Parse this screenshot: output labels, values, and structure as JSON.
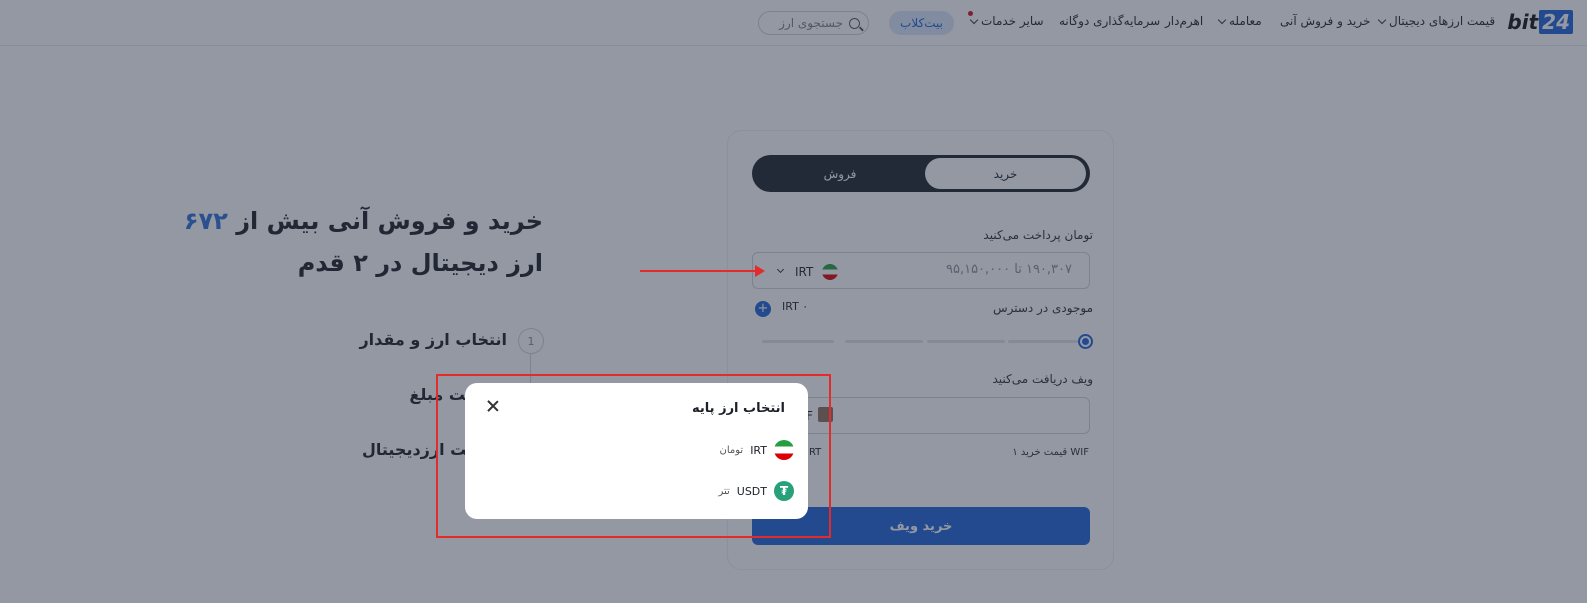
{
  "header": {
    "logo_text": "bit",
    "logo_num": "24",
    "nav": {
      "prices": "قیمت ارزهای دیجیتال",
      "instant": "خرید و فروش آنی",
      "trade": "معامله",
      "leverage": "اهرم‌دار",
      "dual": "سرمایه‌گذاری دوگانه",
      "other": "سایر خدمات"
    },
    "club_label": "بیت‌کلاب",
    "search_placeholder": "جستجوی ارز"
  },
  "hero": {
    "title_part1": "خرید و فروش آنی بیش از ",
    "title_count": "۶۷۲",
    "title_part2": "ارز دیجیتال در ۲ قدم",
    "steps": [
      "انتخاب ارز و مقدار",
      "پرداخت مبلغ",
      "دریافت ارزدیجیتال"
    ],
    "step_number": "1"
  },
  "trade": {
    "buy_tab": "خرید",
    "sell_tab": "فروش",
    "pay_label": "تومان پرداخت می‌کنید",
    "pay_range": "۱۹۰,۳۰۷ تا ۹۵,۱۵۰,۰۰۰",
    "pay_currency": "IRT",
    "balance_label": "موجودی در دسترس",
    "balance_value": "IRT ۰",
    "receive_label": "ویف دریافت می‌کنید",
    "receive_currency": "F",
    "price_label": "قیمت خرید ۱ WIF",
    "price_currency": "IRT",
    "submit_label": "خرید ویف",
    "plus": "+"
  },
  "modal": {
    "title": "انتخاب ارز پایه",
    "options": [
      {
        "code": "IRT",
        "name": "تومان",
        "icon": "iran-flag-icon"
      },
      {
        "code": "USDT",
        "name": "تتر",
        "icon": "tether-icon"
      }
    ]
  },
  "colors": {
    "accent": "#1e63d6",
    "annotation": "#e32b2b"
  }
}
